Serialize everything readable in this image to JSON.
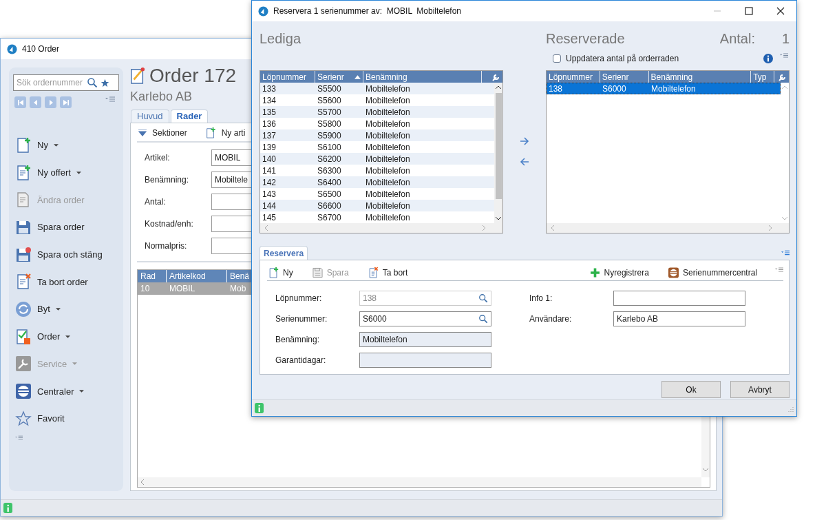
{
  "order_window": {
    "title": "410 Order",
    "search": {
      "placeholder": "Sök ordernummer"
    },
    "actions": [
      {
        "label": "Ny",
        "dropdown": true,
        "disabled": false
      },
      {
        "label": "Ny offert",
        "dropdown": true,
        "disabled": false
      },
      {
        "label": "Ändra order",
        "dropdown": false,
        "disabled": true
      },
      {
        "label": "Spara order",
        "dropdown": false,
        "disabled": false
      },
      {
        "label": "Spara och stäng",
        "dropdown": false,
        "disabled": false
      },
      {
        "label": "Ta bort order",
        "dropdown": false,
        "disabled": false
      },
      {
        "label": "Byt",
        "dropdown": true,
        "disabled": false
      },
      {
        "label": "Order",
        "dropdown": true,
        "disabled": false
      },
      {
        "label": "Service",
        "dropdown": true,
        "disabled": true
      },
      {
        "label": "Centraler",
        "dropdown": true,
        "disabled": false
      },
      {
        "label": "Favorit",
        "dropdown": false,
        "disabled": false
      }
    ],
    "heading": "Order 172",
    "customer": "Karlebo AB",
    "tabs": [
      {
        "label": "Huvud",
        "selected": false
      },
      {
        "label": "Rader",
        "selected": true
      }
    ],
    "toolbar": [
      "Sektioner",
      "Ny arti"
    ],
    "fields": [
      {
        "label": "Artikel:",
        "value": "MOBIL"
      },
      {
        "label": "Benämning:",
        "value": "Mobiltele"
      },
      {
        "label": "Antal:"
      },
      {
        "label": "Kostnad/enh:"
      },
      {
        "label": "Normalpris:"
      }
    ],
    "table": {
      "columns": [
        "Rad",
        "Artikelkod",
        "Benä"
      ],
      "rows": [
        {
          "cells": [
            "10",
            "MOBIL",
            "Mob"
          ],
          "selected": true
        }
      ]
    }
  },
  "dialog": {
    "title": "Reservera 1 serienummer av:  MOBIL  Mobiltelefon",
    "available": {
      "heading": "Lediga",
      "columns": [
        {
          "label": "Löpnummer",
          "sorted": false
        },
        {
          "label": "Serienr",
          "sorted": true
        },
        {
          "label": "Benämning",
          "sorted": false
        }
      ],
      "rows": [
        {
          "cells": [
            "133",
            "S5500",
            "Mobiltelefon"
          ],
          "selected": false
        },
        {
          "cells": [
            "134",
            "S5600",
            "Mobiltelefon"
          ],
          "selected": false
        },
        {
          "cells": [
            "135",
            "S5700",
            "Mobiltelefon"
          ],
          "selected": false
        },
        {
          "cells": [
            "136",
            "S5800",
            "Mobiltelefon"
          ],
          "selected": false
        },
        {
          "cells": [
            "137",
            "S5900",
            "Mobiltelefon"
          ],
          "selected": false
        },
        {
          "cells": [
            "139",
            "S6100",
            "Mobiltelefon"
          ],
          "selected": false
        },
        {
          "cells": [
            "140",
            "S6200",
            "Mobiltelefon"
          ],
          "selected": false
        },
        {
          "cells": [
            "141",
            "S6300",
            "Mobiltelefon"
          ],
          "selected": false
        },
        {
          "cells": [
            "142",
            "S6400",
            "Mobiltelefon"
          ],
          "selected": false
        },
        {
          "cells": [
            "143",
            "S6500",
            "Mobiltelefon"
          ],
          "selected": false
        },
        {
          "cells": [
            "144",
            "S6600",
            "Mobiltelefon"
          ],
          "selected": false
        },
        {
          "cells": [
            "145",
            "S6700",
            "Mobiltelefon"
          ],
          "selected": false
        }
      ]
    },
    "reserved": {
      "heading": "Reserverade",
      "count_label": "Antal:",
      "count": "1",
      "update_checkbox": {
        "label": "Uppdatera antal på orderraden",
        "checked": false
      },
      "columns": [
        "Löpnummer",
        "Serienr",
        "Benämning",
        "Typ"
      ],
      "rows": [
        {
          "cells": [
            "138",
            "S6000",
            "Mobiltelefon"
          ],
          "selected": true
        }
      ]
    },
    "tabs": [
      {
        "label": "Reservera",
        "selected": true
      }
    ],
    "toolbar": [
      {
        "label": "Ny",
        "disabled": false
      },
      {
        "label": "Spara",
        "disabled": true
      },
      {
        "label": "Ta bort",
        "disabled": false
      }
    ],
    "toolbar_right": [
      "Nyregistrera",
      "Serienummercentral"
    ],
    "fields_left": [
      {
        "label": "Löpnummer:",
        "value": "138",
        "kind": "search",
        "disabled": true
      },
      {
        "label": "Serienummer:",
        "value": "S6000",
        "kind": "search",
        "disabled": false
      },
      {
        "label": "Benämning:",
        "value": "Mobiltelefon",
        "kind": "readonly",
        "disabled": false
      },
      {
        "label": "Garantidagar:",
        "kind": "readonly",
        "disabled": false
      }
    ],
    "fields_right": [
      {
        "label": "Info 1:"
      },
      {
        "label": "Användare:",
        "value": "Karlebo AB"
      }
    ],
    "buttons": [
      "Ok",
      "Avbryt"
    ]
  }
}
